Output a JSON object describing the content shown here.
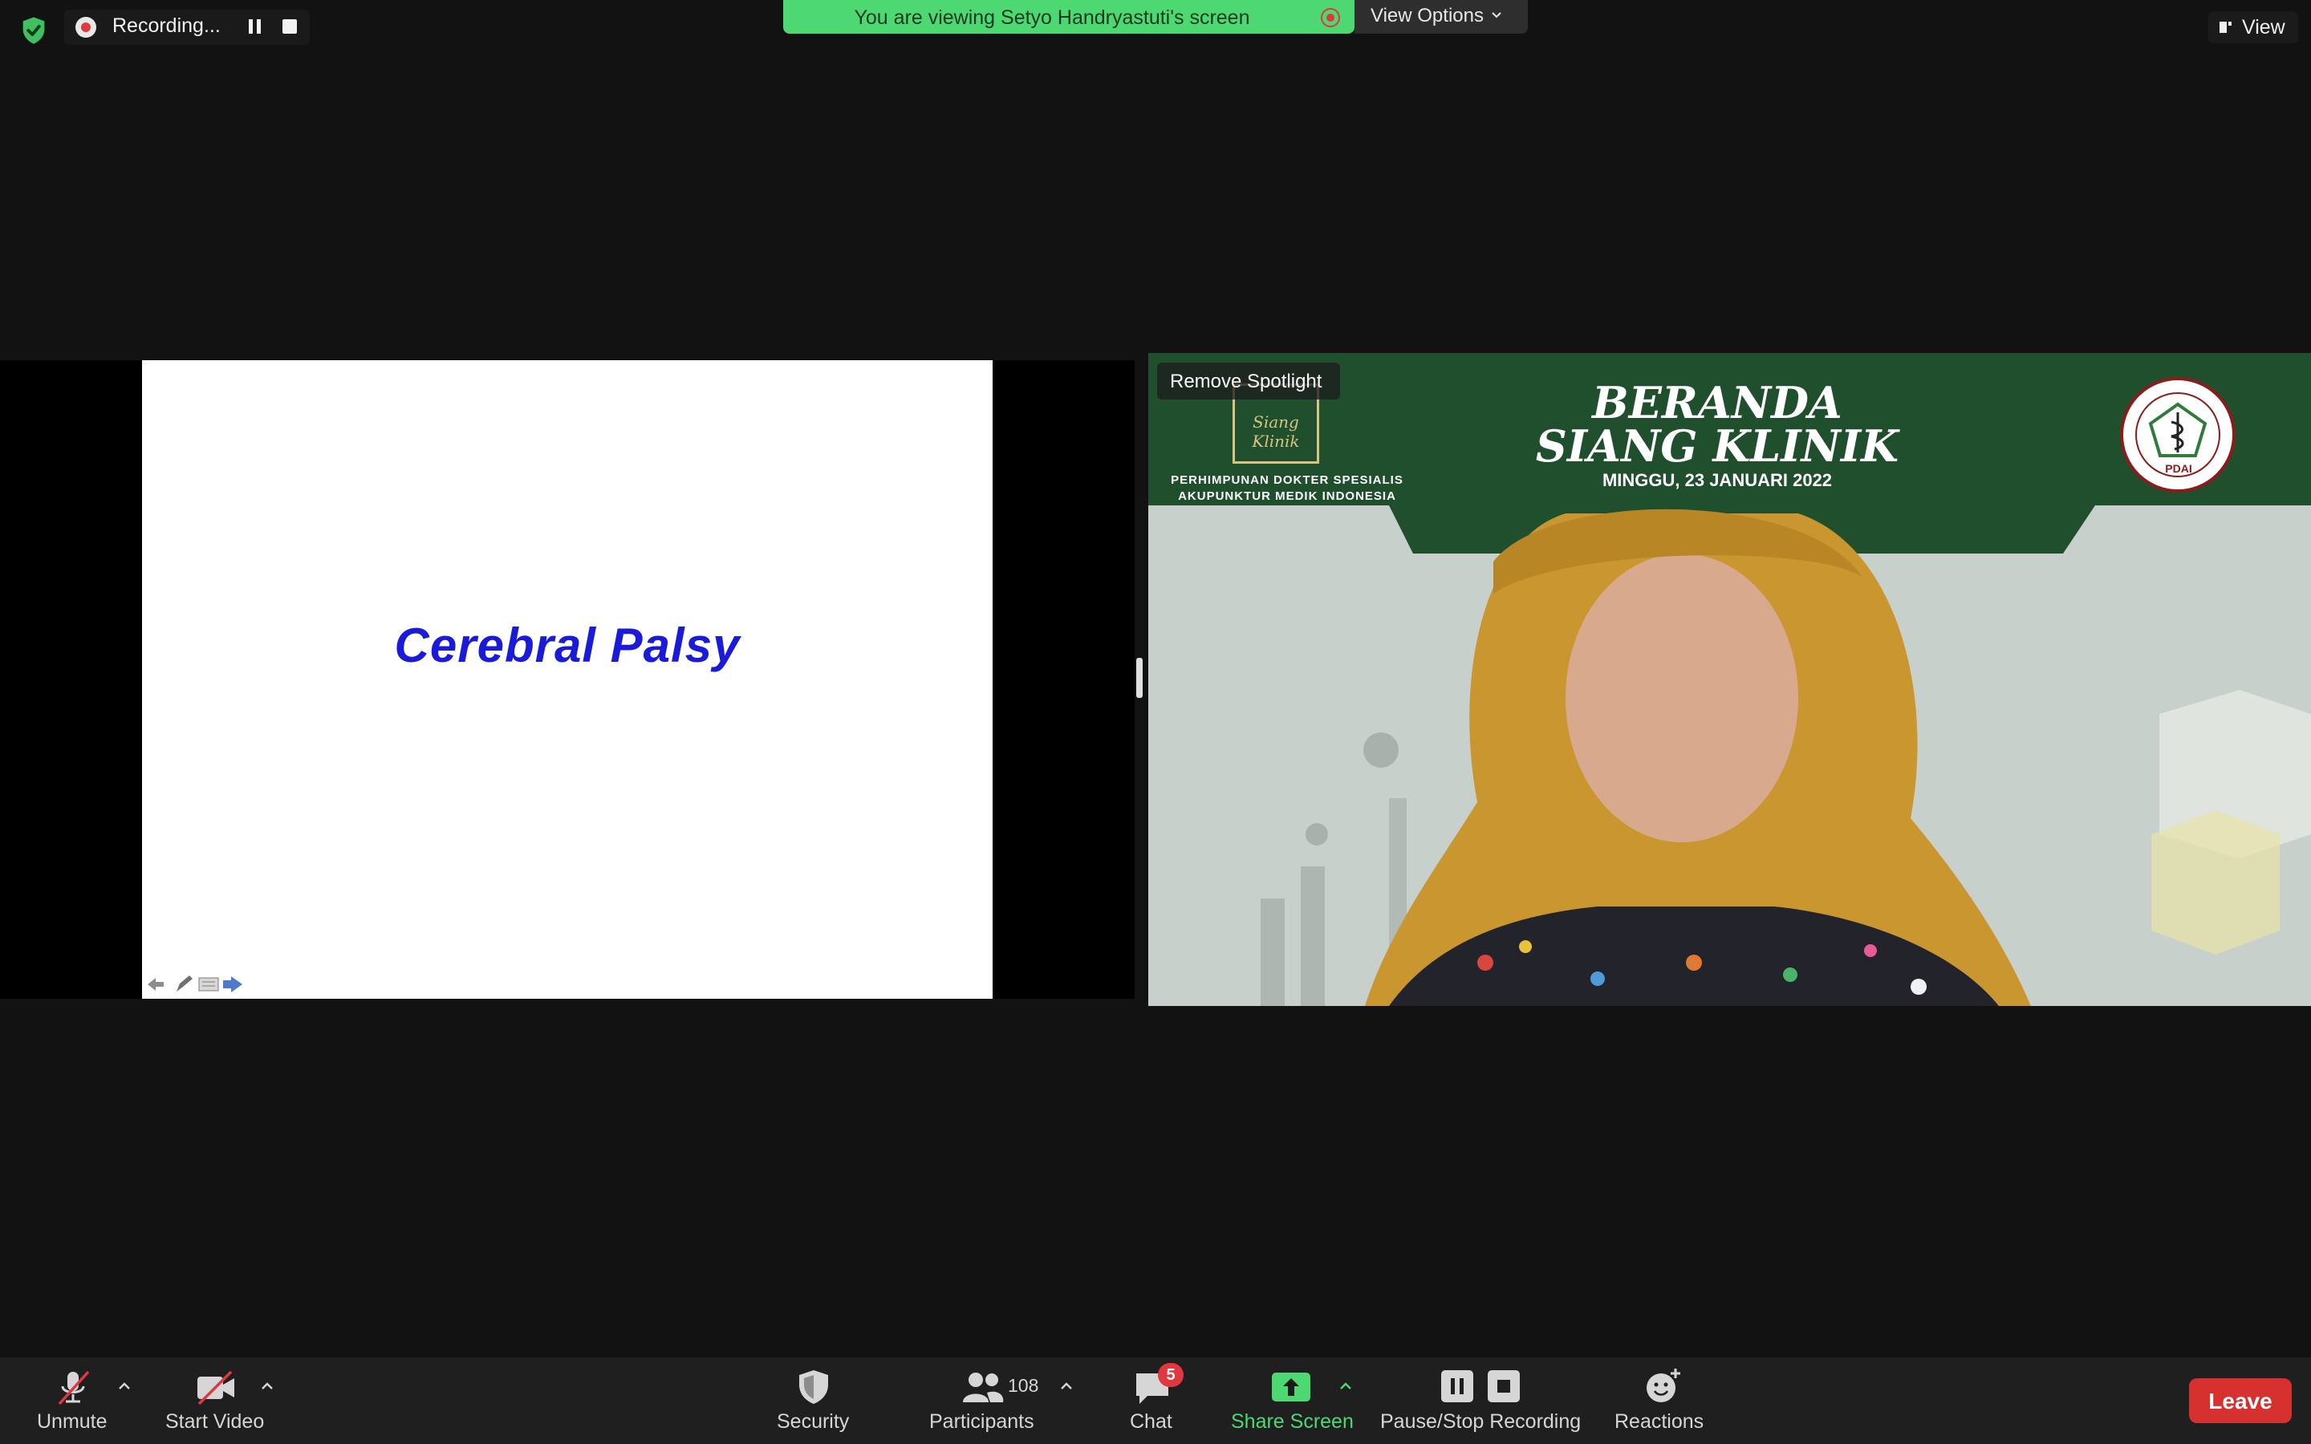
{
  "recording": {
    "label": "Recording..."
  },
  "banner": {
    "text": "You are viewing Setyo Handryastuti's screen",
    "view_options": "View Options"
  },
  "view_menu": {
    "label": "View"
  },
  "slide": {
    "title": "Cerebral Palsy"
  },
  "video": {
    "spotlight_button": "Remove Spotlight",
    "title_line1": "BERANDA",
    "title_line2": "SIANG KLINIK",
    "date": "MINGGU, 23 JANUARI 2022",
    "org_line1": "PERHIMPUNAN DOKTER SPESIALIS",
    "org_line2": "AKUPUNKTUR MEDIK  INDONESIA",
    "logo_text": "Siang Klinik",
    "emblem_text": "PDAI"
  },
  "toolbar": {
    "unmute": "Unmute",
    "start_video": "Start Video",
    "security": "Security",
    "participants": "Participants",
    "participant_count": "108",
    "chat": "Chat",
    "chat_badge": "5",
    "share_screen": "Share Screen",
    "record": "Pause/Stop Recording",
    "reactions": "Reactions",
    "leave": "Leave"
  },
  "colors": {
    "share_green": "#4dd872",
    "leave_red": "#d6302f",
    "record_red": "#e0383e",
    "slide_title_blue": "#1a1adb"
  },
  "icons": [
    "shield-check-icon",
    "record-dot-icon",
    "pause-icon",
    "stop-icon",
    "chevron-down-icon",
    "view-layout-icon",
    "muted-mic-icon",
    "video-off-icon",
    "security-shield-icon",
    "participants-icon",
    "chat-bubble-icon",
    "share-screen-arrow-icon",
    "reactions-smiley-icon"
  ]
}
